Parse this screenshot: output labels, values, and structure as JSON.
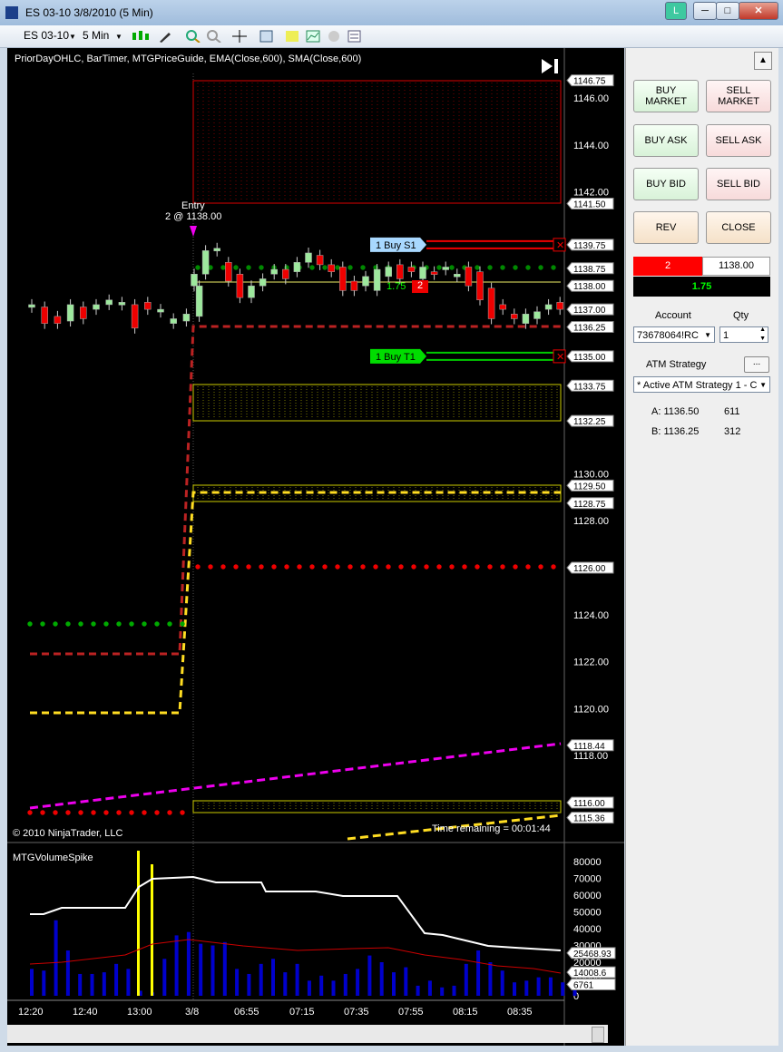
{
  "window": {
    "title": "ES 03-10  3/8/2010 (5 Min)",
    "badge": "L",
    "minimize": "─",
    "maximize": "□",
    "close": "✕"
  },
  "toolbar": {
    "instrument": "ES 03-10",
    "interval": "5 Min",
    "icons": [
      "candlestick-icon",
      "pencil-icon",
      "zoom-in-icon",
      "zoom-out-icon",
      "crosshair-icon",
      "properties-icon",
      "strategy-icon",
      "indicator-icon",
      "data-box-icon",
      "list-icon"
    ]
  },
  "chart": {
    "indicators_label": "PriorDayOHLC, BarTimer, MTGPriceGuide, EMA(Close,600), SMA(Close,600)",
    "copyright": "© 2010 NinjaTrader, LLC",
    "time_remaining": "Time remaining = 00:01:44",
    "entry_label": "Entry",
    "entry_detail": "2 @ 1138.00",
    "pnl_label": "1.75",
    "position_qty": "2",
    "orders": [
      {
        "qty": "1",
        "label": "Buy S1",
        "price": 1139.75,
        "color": "#a8d8ff"
      },
      {
        "qty": "1",
        "label": "Buy T1",
        "price": 1135.0,
        "color": "#00dd00"
      }
    ],
    "price_axis": [
      "1146.00",
      "1144.00",
      "1142.00",
      "1130.00",
      "1128.00",
      "1126.00",
      "1124.00",
      "1122.00",
      "1120.00",
      "1118.00"
    ],
    "price_tags": [
      {
        "label": "1146.75",
        "price": 1146.75
      },
      {
        "label": "1141.50",
        "price": 1141.5
      },
      {
        "label": "1139.75",
        "price": 1139.75
      },
      {
        "label": "1138.75",
        "price": 1138.75
      },
      {
        "label": "1138.00",
        "price": 1138.0
      },
      {
        "label": "1137.00",
        "price": 1137.0
      },
      {
        "label": "1136.25",
        "price": 1136.25
      },
      {
        "label": "1135.00",
        "price": 1135.0
      },
      {
        "label": "1133.75",
        "price": 1133.75
      },
      {
        "label": "1132.25",
        "price": 1132.25
      },
      {
        "label": "1129.50",
        "price": 1129.5
      },
      {
        "label": "1128.75",
        "price": 1128.75
      },
      {
        "label": "1126.00",
        "price": 1126.0
      },
      {
        "label": "1118.44",
        "price": 1118.44
      },
      {
        "label": "1116.00",
        "price": 1116.0
      },
      {
        "label": "1115.36",
        "price": 1115.36
      }
    ]
  },
  "volume_panel": {
    "label": "MTGVolumeSpike",
    "axis": [
      "80000",
      "70000",
      "60000",
      "50000",
      "40000",
      "30000",
      "20000",
      "10000",
      "0"
    ],
    "tags": [
      "25468.93",
      "14008.6",
      "6761"
    ],
    "time_labels": [
      "12:20",
      "12:40",
      "13:00",
      "3/8",
      "06:55",
      "07:15",
      "07:35",
      "07:55",
      "08:15",
      "08:35"
    ]
  },
  "panel": {
    "buy_market": "BUY MARKET",
    "sell_market": "SELL MARKET",
    "buy_ask": "BUY ASK",
    "sell_ask": "SELL ASK",
    "buy_bid": "BUY BID",
    "sell_bid": "SELL BID",
    "rev": "REV",
    "close": "CLOSE",
    "position_qty": "2",
    "position_price": "1138.00",
    "pnl": "1.75",
    "account_label": "Account",
    "qty_label": "Qty",
    "account_value": "73678064!RC",
    "qty_value": "1",
    "atm_label": "ATM Strategy",
    "atm_button": "...",
    "atm_value": "* Active ATM Strategy 1 - C",
    "ask_label": "A: 1136.50",
    "ask_size": "611",
    "bid_label": "B: 1136.25",
    "bid_size": "312"
  },
  "chart_data": {
    "type": "candlestick",
    "bars_open": [
      1137.1,
      1137.1,
      1136.7,
      1136.5,
      1137.1,
      1137.0,
      1137.2,
      1137.2,
      1137.2,
      1137.3,
      1137.0,
      1136.4,
      1136.5,
      1136.7,
      1138.0,
      1138.5,
      1139.5,
      1139.0,
      1138.5,
      1137.5,
      1138.0,
      1138.5,
      1138.7,
      1138.6,
      1139.0,
      1139.3,
      1138.9,
      1138.8,
      1138.2,
      1138.0,
      1137.8,
      1138.4,
      1138.9,
      1138.8,
      1138.3,
      1138.6,
      1138.8,
      1138.5,
      1138.8,
      1138.6,
      1137.9,
      1137.2,
      1136.8,
      1136.4,
      1136.6,
      1137.0,
      1137.3
    ],
    "bars_close": [
      1137.2,
      1136.4,
      1136.4,
      1137.2,
      1136.6,
      1137.2,
      1137.4,
      1137.3,
      1136.2,
      1137.0,
      1137.0,
      1136.6,
      1136.8,
      1138.0,
      1138.5,
      1139.5,
      1139.6,
      1138.2,
      1137.5,
      1138.0,
      1138.3,
      1138.7,
      1138.3,
      1139.0,
      1139.4,
      1138.9,
      1138.6,
      1137.8,
      1137.8,
      1138.4,
      1138.7,
      1138.8,
      1138.3,
      1138.6,
      1138.8,
      1138.5,
      1138.8,
      1138.5,
      1138.0,
      1137.4,
      1136.6,
      1137.0,
      1136.6,
      1136.8,
      1136.9,
      1137.2,
      1137.0
    ]
  }
}
